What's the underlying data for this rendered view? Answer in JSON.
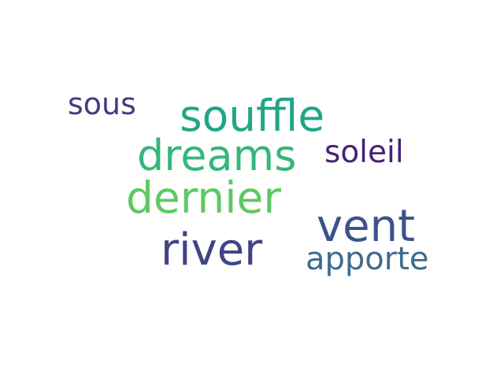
{
  "words": [
    {
      "id": "w-sous",
      "text": "sous",
      "color": "#443a83"
    },
    {
      "id": "w-souffle",
      "text": "souffle",
      "color": "#21a685"
    },
    {
      "id": "w-dreams",
      "text": "dreams",
      "color": "#35b779"
    },
    {
      "id": "w-soleil",
      "text": "soleil",
      "color": "#482173"
    },
    {
      "id": "w-dernier",
      "text": "dernier",
      "color": "#5ec962"
    },
    {
      "id": "w-vent",
      "text": "vent",
      "color": "#3b528b"
    },
    {
      "id": "w-river",
      "text": "river",
      "color": "#414487"
    },
    {
      "id": "w-apporte",
      "text": "apporte",
      "color": "#3e6c8d"
    }
  ]
}
